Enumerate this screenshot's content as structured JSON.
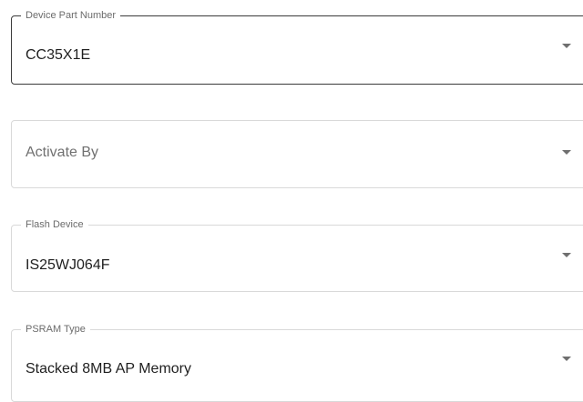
{
  "fields": [
    {
      "label": "Device Part Number",
      "value": "CC35X1E",
      "state": "focused"
    },
    {
      "label": "",
      "placeholder": "Activate By",
      "value": ""
    },
    {
      "label": "Flash Device",
      "value": "IS25WJ064F"
    },
    {
      "label": "PSRAM Type",
      "value": "Stacked 8MB AP Memory"
    }
  ],
  "icons": {
    "dropdown": "triangle-down-icon"
  },
  "colors": {
    "border_default": "#d9d9d9",
    "border_focused": "#3a3a3a",
    "label_text": "#6b6b6b",
    "value_text": "#1f1f1f",
    "placeholder_text": "#707070"
  }
}
